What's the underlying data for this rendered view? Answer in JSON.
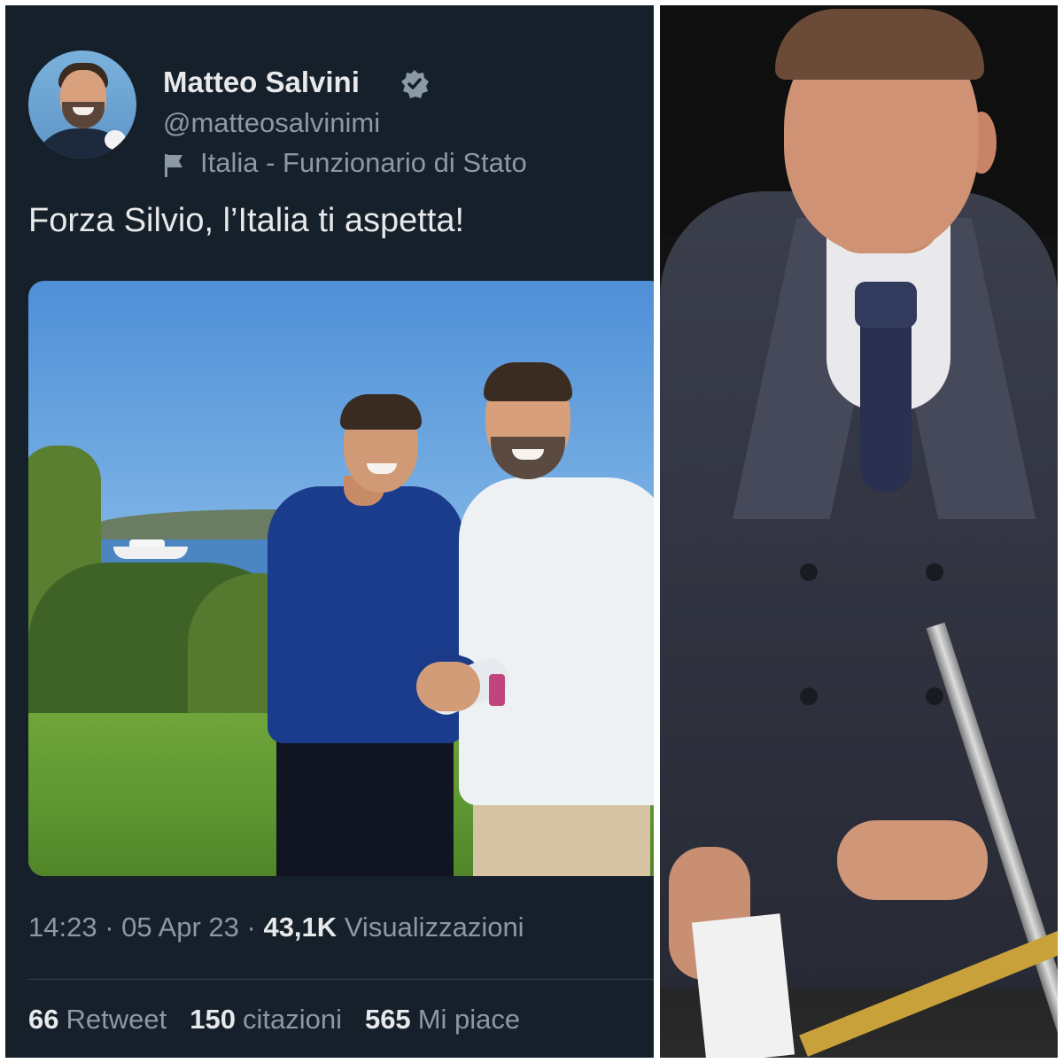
{
  "tweet": {
    "user_name": "Matteo Salvini",
    "handle": "@matteosalvinimi",
    "affiliation": "Italia - Funzionario di Stato",
    "text": "Forza Silvio, l’Italia ti aspetta!",
    "time": "14:23",
    "date": "05 Apr 23",
    "views_count": "43,1K",
    "views_label": "Visualizzazioni",
    "separator": "·",
    "stats": [
      {
        "count": "66",
        "label": "Retweet"
      },
      {
        "count": "150",
        "label": "citazioni"
      },
      {
        "count": "565",
        "label": "Mi piace"
      }
    ]
  },
  "colors": {
    "tweet_bg": "#15202b",
    "primary_text": "#e7e9ea",
    "secondary_text": "#8b98a5",
    "divider": "#38444d"
  },
  "icons": {
    "verified": "verified-badge-icon",
    "affiliation": "flag-icon"
  }
}
